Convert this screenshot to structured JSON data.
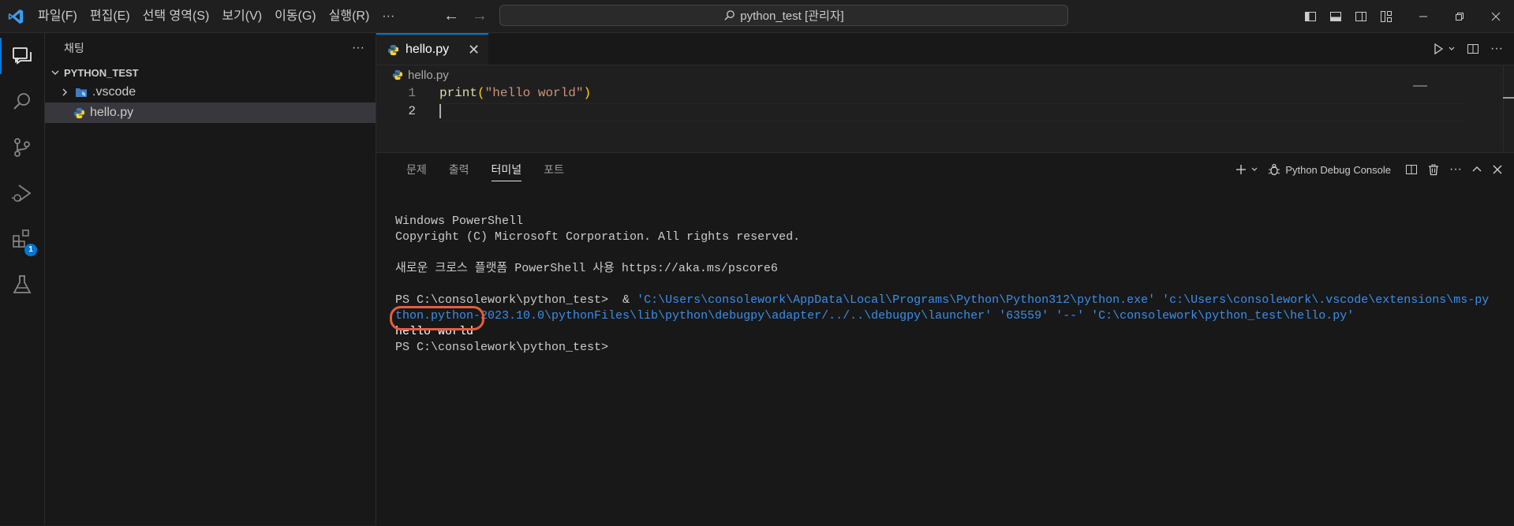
{
  "titlebar": {
    "menu": [
      "파일(F)",
      "편집(E)",
      "선택 영역(S)",
      "보기(V)",
      "이동(G)",
      "실행(R)",
      "···"
    ],
    "search_text": "python_test [관리자]"
  },
  "activity": {
    "extensions_badge": "1"
  },
  "sidebar": {
    "title": "채팅",
    "more": "···",
    "section": "PYTHON_TEST",
    "items": [
      {
        "label": ".vscode"
      },
      {
        "label": "hello.py"
      }
    ]
  },
  "editor": {
    "tab_label": "hello.py",
    "breadcrumb": "hello.py",
    "lines": [
      {
        "num": "1",
        "fn": "print",
        "open": "(",
        "str": "\"hello world\"",
        "close": ")"
      },
      {
        "num": "2"
      }
    ]
  },
  "panel": {
    "tabs": [
      "문제",
      "출력",
      "터미널",
      "포트"
    ],
    "active_tab": "터미널",
    "debug_console_label": "Python Debug Console",
    "terminal": {
      "line1": "Windows PowerShell",
      "line2": "Copyright (C) Microsoft Corporation. All rights reserved.",
      "line3": "새로운 크로스 플랫폼 PowerShell 사용 https://aka.ms/pscore6",
      "prompt1": "PS C:\\consolework\\python_test>  & ",
      "cmd1": "'C:\\Users\\consolework\\AppData\\Local\\Programs\\Python\\Python312\\python.exe' 'c:\\Users\\consolework\\.vscode\\extensions\\ms-py",
      "cmd2": "thon.python-2023.10.0\\pythonFiles\\lib\\python\\debugpy\\adapter/../..\\debugpy\\launcher' '63559' '--' 'C:\\consolework\\python_test\\hello.py'",
      "output": "hello world",
      "prompt2": "PS C:\\consolework\\python_test>"
    }
  },
  "colors": {
    "accent": "#0078d4",
    "highlight_circle": "#e85d3a",
    "command_text": "#3b8eea"
  }
}
